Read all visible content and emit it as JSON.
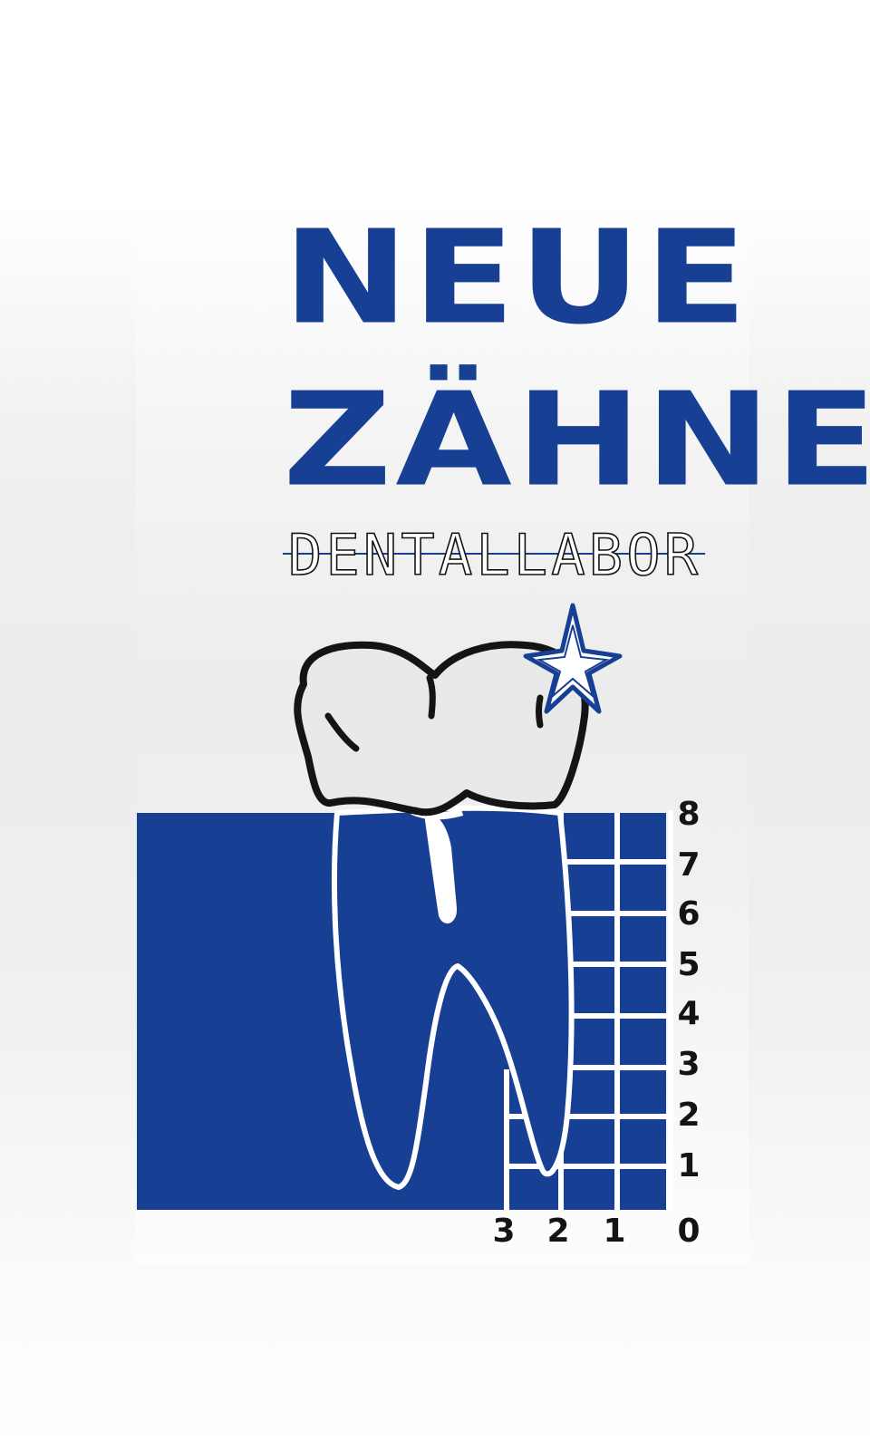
{
  "logo": {
    "line1": "NEUE",
    "line2": "ZÄHNE",
    "subtitle": "DENTALLABOR",
    "colors": {
      "blue": "#173f93",
      "black": "#141414",
      "crown": "#e9e9e9"
    },
    "scale_vertical": [
      "8",
      "7",
      "6",
      "5",
      "4",
      "3",
      "2",
      "1",
      "0"
    ],
    "scale_horizontal": [
      "3",
      "2",
      "1"
    ],
    "icons": [
      "tooth-icon",
      "star-icon"
    ]
  }
}
